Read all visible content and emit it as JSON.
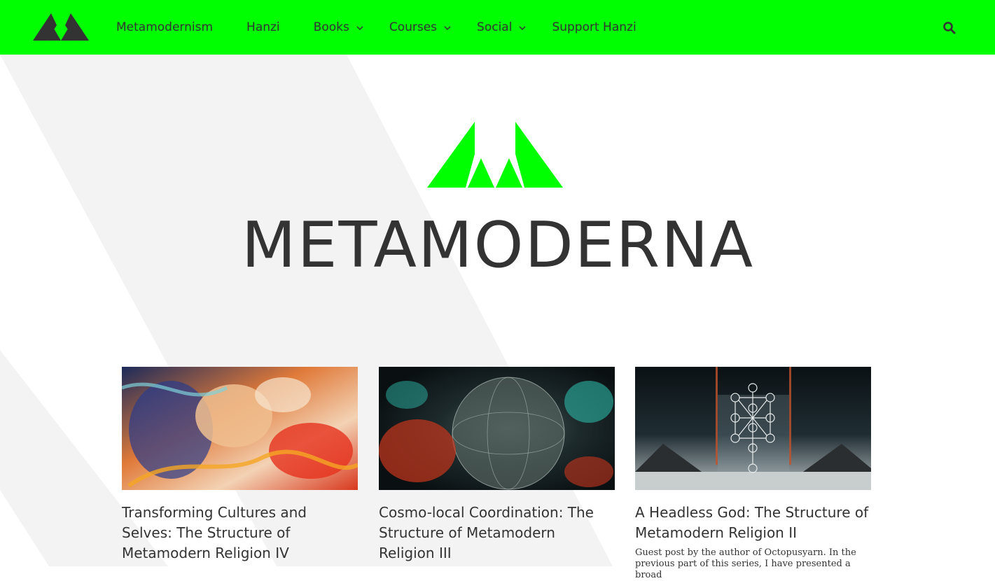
{
  "colors": {
    "accent": "#00ff00",
    "text": "#333333",
    "background": "#ffffff",
    "watermark": "#f3f3f3"
  },
  "header": {
    "logo_icon": "metamoderna-triangles-icon",
    "nav": [
      {
        "label": "Metamodernism",
        "has_submenu": false
      },
      {
        "label": "Hanzi",
        "has_submenu": false
      },
      {
        "label": "Books",
        "has_submenu": true
      },
      {
        "label": "Courses",
        "has_submenu": true
      },
      {
        "label": "Social",
        "has_submenu": true
      },
      {
        "label": "Support Hanzi",
        "has_submenu": false
      }
    ],
    "search_icon": "search-icon"
  },
  "hero": {
    "title": "METAMODERNA"
  },
  "posts": [
    {
      "title": "Transforming Cultures and Selves: The Structure of Metamodern Religion IV",
      "image": "abstract-colorful-faces-painting",
      "excerpt": ""
    },
    {
      "title": "Cosmo-local Coordination: The Structure of Metamodern Religion III",
      "image": "cosmic-globe-illustration",
      "excerpt": ""
    },
    {
      "title": "A Headless God: The Structure of Metamodern Religion II",
      "image": "tree-of-life-diagram-illustration",
      "excerpt": "Guest post by the author of Octopusyarn. In the previous part of this series, I have presented a broad"
    }
  ]
}
